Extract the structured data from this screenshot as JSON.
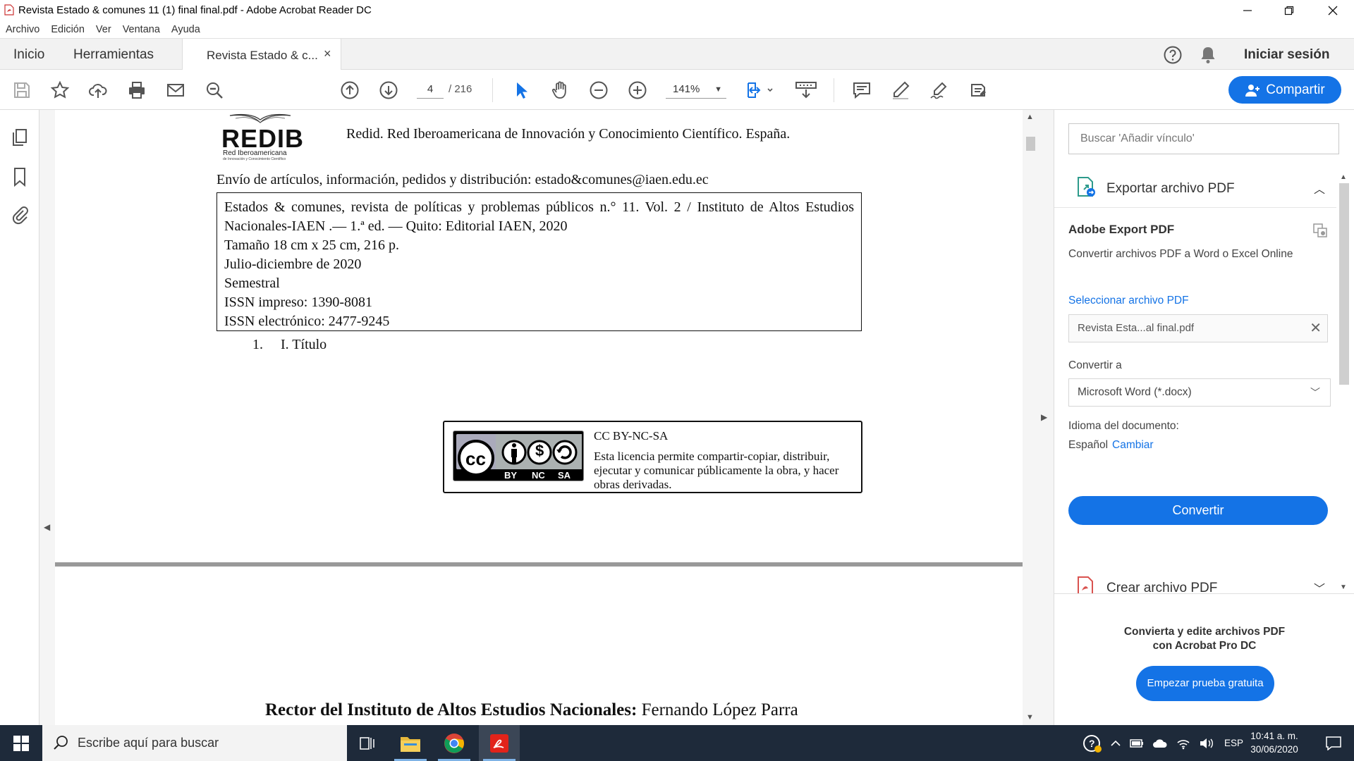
{
  "window": {
    "title": "Revista Estado & comunes 11 (1) final final.pdf - Adobe Acrobat Reader DC"
  },
  "menu": [
    "Archivo",
    "Edición",
    "Ver",
    "Ventana",
    "Ayuda"
  ],
  "tabs": {
    "home": "Inicio",
    "tools": "Herramientas",
    "document": "Revista Estado & c...",
    "close_symbol": "×",
    "sign_in": "Iniciar sesión"
  },
  "toolbar": {
    "current_page": "4",
    "total_pages": "/  216",
    "zoom": "141%",
    "share_label": "Compartir"
  },
  "document": {
    "redib_logo_word": "REDIB",
    "redib_logo_sub": "Red Iberoamericana",
    "redib_logo_sub2": "de Innovación y Conocimiento Científico",
    "redib_line": "Redid. Red Iberoamericana de Innovación y Conocimiento Científico. España.",
    "envio_line": "Envío de artículos, información, pedidos y distribución: estado&comunes@iaen.edu.ec",
    "info": {
      "line1": "Estados & comunes, revista de políticas y problemas públicos n.° 11. Vol. 2 / Instituto de Altos Estudios Nacionales-IAEN .— 1.ª ed. — Quito: Editorial IAEN, 2020",
      "line2": "Tamaño 18 cm x 25 cm, 216 p.",
      "line3": "Julio-diciembre de 2020",
      "line4": "Semestral",
      "line5": "ISSN impreso: 1390-8081",
      "line6": "ISSN electrónico: 2477-9245",
      "list_number": "1.",
      "list_item": "I. Título"
    },
    "license": {
      "badge_labels": [
        "BY",
        "NC",
        "SA"
      ],
      "badge_cc": "cc",
      "title": "CC BY-NC-SA",
      "description": "Esta licencia permite compartir-copiar, distribuir, ejecutar y comunicar públicamente la obra, y hacer obras derivadas."
    },
    "page2": {
      "rector_label": "Rector del Instituto de Altos Estudios Nacionales:",
      "rector_name": " Fernando López Parra"
    }
  },
  "right_panel": {
    "search_placeholder": "Buscar 'Añadir vínculo'",
    "export_section_title": "Exportar archivo PDF",
    "adobe_export_title": "Adobe Export PDF",
    "adobe_export_desc": "Convertir archivos PDF a Word o Excel Online",
    "select_file_label": "Seleccionar archivo PDF",
    "selected_file": "Revista Esta...al final.pdf",
    "convert_to_label": "Convertir a",
    "convert_to_value": "Microsoft Word (*.docx)",
    "doc_language_label": "Idioma del documento:",
    "doc_language_value": "Español",
    "change_link": "Cambiar",
    "convert_button": "Convertir",
    "create_section_title": "Crear archivo PDF",
    "promo_line1": "Convierta y edite archivos PDF",
    "promo_line2": "con Acrobat Pro DC",
    "trial_button": "Empezar prueba gratuita"
  },
  "taskbar": {
    "search_placeholder": "Escribe aquí para buscar",
    "language": "ESP",
    "time": "10:41 a. m.",
    "date": "30/06/2020"
  },
  "colors": {
    "accent": "#1473e6",
    "taskbar": "#1e2a3a"
  }
}
